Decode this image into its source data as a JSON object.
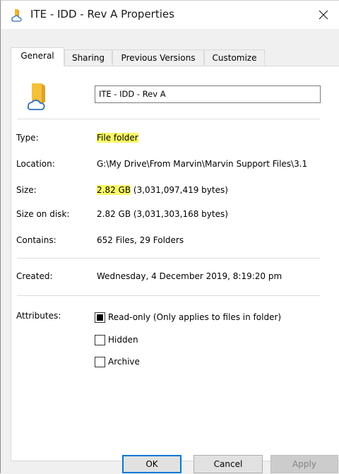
{
  "window": {
    "title": "ITE - IDD - Rev A Properties"
  },
  "tabs": [
    {
      "label": "General"
    },
    {
      "label": "Sharing"
    },
    {
      "label": "Previous Versions"
    },
    {
      "label": "Customize"
    }
  ],
  "general": {
    "folder_name": "ITE - IDD - Rev A",
    "type": {
      "label": "Type:",
      "value": "File folder"
    },
    "location": {
      "label": "Location:",
      "value": "G:\\My Drive\\From Marvin\\Marvin Support Files\\3.1"
    },
    "size": {
      "label": "Size:",
      "value_highlight": "2.82 GB",
      "value_rest": " (3,031,097,419 bytes)"
    },
    "size_on_disk": {
      "label": "Size on disk:",
      "value": "2.82 GB (3,031,303,168 bytes)"
    },
    "contains": {
      "label": "Contains:",
      "value": "652 Files, 29 Folders"
    },
    "created": {
      "label": "Created:",
      "value": "Wednesday, 4 December 2019, 8:19:20 pm"
    },
    "attributes": {
      "label": "Attributes:",
      "read_only": {
        "label": "Read-only (Only applies to files in folder)",
        "state": "indeterminate"
      },
      "hidden": {
        "label": "Hidden",
        "state": "unchecked"
      },
      "archive": {
        "label": "Archive",
        "state": "unchecked"
      }
    }
  },
  "buttons": {
    "ok": "OK",
    "cancel": "Cancel",
    "apply": "Apply"
  },
  "colors": {
    "highlight": "#fafa66",
    "accent": "#0078d7",
    "folder": "#f5c13a"
  }
}
